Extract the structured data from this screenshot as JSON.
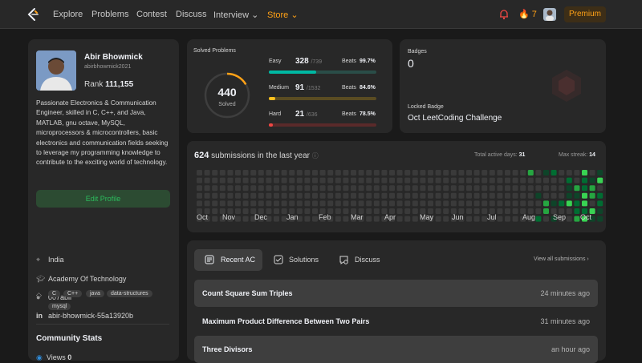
{
  "nav": {
    "items": [
      "Explore",
      "Problems",
      "Contest",
      "Discuss",
      "Interview ⌄",
      "Store ⌄"
    ],
    "streak": "7",
    "premium": "Premium"
  },
  "profile": {
    "name": "Abir Bhowmick",
    "username": "abirbhowmick2021",
    "rank_label": "Rank",
    "rank": "111,155",
    "bio": "Passionate Electronics & Communication Engineer, skilled in C, C++, and Java, MATLAB, gnu octave, MySQL, microprocessors & microcontrollers, basic electronics and communication fields seeking to leverage my programming knowledge to contribute to the exciting world of technology.",
    "edit_button": "Edit Profile",
    "location": "India",
    "school": "Academy Of Technology",
    "github": "007abir",
    "linkedin": "abir-bhowmick-55a13920b",
    "skills": [
      "C",
      "C++",
      "java",
      "data-structures",
      "mysql"
    ],
    "community_title": "Community Stats",
    "views_label": "Views",
    "views": "0"
  },
  "solved": {
    "title": "Solved Problems",
    "total": "440",
    "total_label": "Solved",
    "beats_label": "Beats",
    "difficulties": [
      {
        "label": "Easy",
        "solved": "328",
        "total": "/739",
        "beats": "99.7%",
        "fraction": 0.444,
        "color": "#00b8a3",
        "track": "#2a4d48"
      },
      {
        "label": "Medium",
        "solved": "91",
        "total": "/1532",
        "beats": "84.6%",
        "fraction": 0.059,
        "color": "#ffc01e",
        "track": "#5a4c22"
      },
      {
        "label": "Hard",
        "solved": "21",
        "total": "/636",
        "beats": "78.5%",
        "fraction": 0.033,
        "color": "#ef4743",
        "track": "#5a2a2a"
      }
    ]
  },
  "badges": {
    "label": "Badges",
    "count": "0",
    "locked_label": "Locked Badge",
    "locked_name": "Oct LeetCoding Challenge"
  },
  "submissions": {
    "count": "624",
    "label": "submissions in the last year",
    "active_label": "Total active days:",
    "active_days": "31",
    "streak_label": "Max streak:",
    "max_streak": "14",
    "months": [
      "Oct",
      "Nov",
      "Dec",
      "Jan",
      "Feb",
      "Mar",
      "Apr",
      "May",
      "Jun",
      "Jul",
      "Aug",
      "Sep",
      "Oct"
    ]
  },
  "recent": {
    "tabs": [
      "Recent AC",
      "Solutions",
      "Discuss"
    ],
    "view_all": "View all submissions ›",
    "rows": [
      {
        "title": "Count Square Sum Triples",
        "time": "24 minutes ago"
      },
      {
        "title": "Maximum Product Difference Between Two Pairs",
        "time": "31 minutes ago"
      },
      {
        "title": "Three Divisors",
        "time": "an hour ago"
      }
    ]
  },
  "colors": {
    "accent": "#ffa116",
    "green": "#2cbb5d",
    "easy": "#00b8a3",
    "medium": "#ffc01e",
    "hard": "#ef4743"
  },
  "icons": [
    "logo-icon",
    "bell-icon",
    "fire-icon",
    "location-icon",
    "school-icon",
    "github-icon",
    "linkedin-icon",
    "tag-icon",
    "eye-icon",
    "list-icon",
    "solution-icon",
    "discuss-icon",
    "info-icon",
    "chevron-right-icon"
  ]
}
